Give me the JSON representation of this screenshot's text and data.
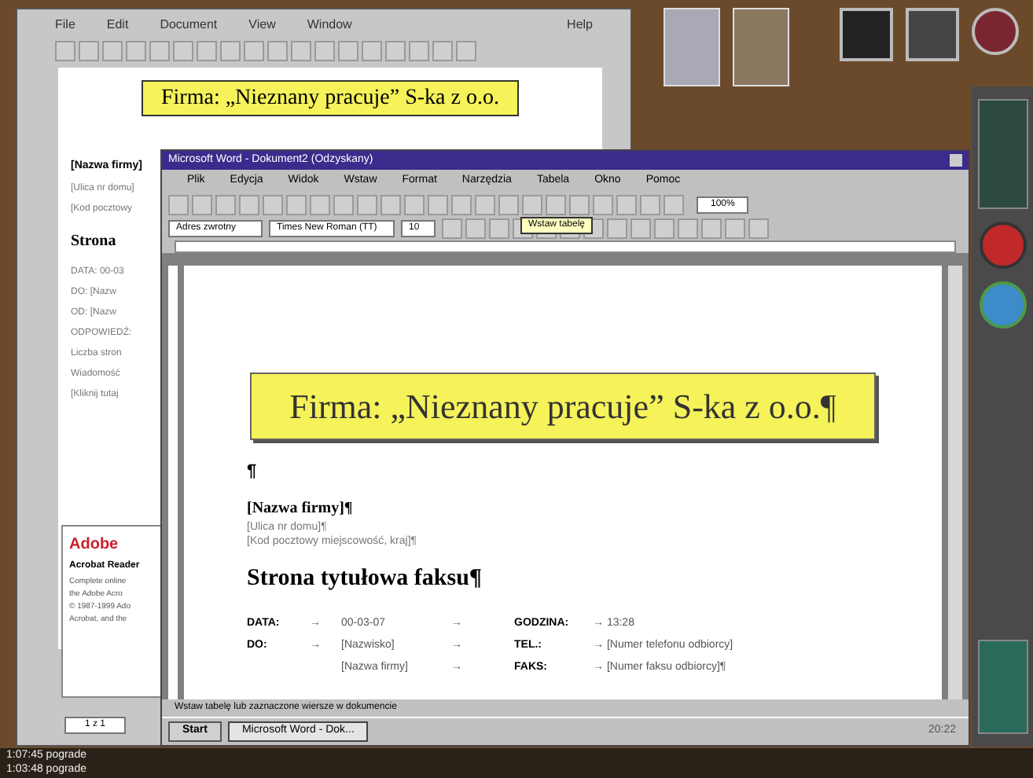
{
  "acrobat_window": {
    "menu": [
      "File",
      "Edit",
      "Document",
      "View",
      "Window",
      "Help"
    ],
    "banner": "Firma: „Nieznany pracuje” S-ka z o.o.",
    "page_lines": [
      {
        "kind": "bold",
        "text": "[Nazwa firmy]"
      },
      {
        "kind": "small",
        "text": "[Ulica nr domu]"
      },
      {
        "kind": "small",
        "text": "[Kod pocztowy"
      },
      {
        "kind": "title",
        "text": "Strona"
      },
      {
        "kind": "small",
        "text": "DATA:    00-03"
      },
      {
        "kind": "small",
        "text": "DO:      [Nazw"
      },
      {
        "kind": "small",
        "text": "OD:      [Nazw"
      },
      {
        "kind": "small",
        "text": "ODPOWIEDŹ:"
      },
      {
        "kind": "small",
        "text": "Liczba stron"
      },
      {
        "kind": "small",
        "text": "Wiadomość"
      },
      {
        "kind": "small",
        "text": "[Kliknij tutaj"
      }
    ],
    "about": {
      "logo": "Adobe",
      "title": "Acrobat Reader",
      "lines": [
        "Complete online",
        "the Adobe Acro",
        "© 1987-1999 Ado",
        "Acrobat, and the"
      ]
    },
    "page_field": "1 z 1"
  },
  "word_window": {
    "title": "Microsoft Word - Dokument2 (Odzyskany)",
    "menu": [
      "Plik",
      "Edycja",
      "Widok",
      "Wstaw",
      "Format",
      "Narzędzia",
      "Tabela",
      "Okno",
      "Pomoc"
    ],
    "style": "Adres zwrotny",
    "font": "Times New Roman (TT)",
    "size": "10",
    "zoom": "100%",
    "tooltip": "Wstaw tabelę",
    "document": [
      {
        "kind": "banner",
        "text": "Firma: „Nieznany pracuje” S-ka z o.o.¶"
      },
      {
        "kind": "mark",
        "text": "¶"
      },
      {
        "kind": "bold",
        "text": "[Nazwa firmy]¶"
      },
      {
        "kind": "small",
        "text": "[Ulica nr domu]¶"
      },
      {
        "kind": "small",
        "text": "[Kod pocztowy miejscowość, kraj]¶"
      },
      {
        "kind": "title",
        "text": "Strona tytułowa faksu¶"
      },
      {
        "kind": "fields",
        "cells": [
          "DATA:",
          "→",
          "00-03-07",
          "→",
          "GODZINA:",
          "→ 13:28"
        ]
      },
      {
        "kind": "fields",
        "cells": [
          "DO:",
          "→",
          "[Nazwisko]",
          "→",
          "TEL.:",
          "→ [Numer telefonu odbiorcy]"
        ]
      },
      {
        "kind": "fields_cont",
        "cells": [
          "[Nazwa firmy]",
          "→",
          "FAKS:",
          "→ [Numer faksu odbiorcy]¶"
        ]
      }
    ],
    "status": "Wstaw tabelę lub zaznaczone wiersze w dokumencie"
  },
  "taskbar": {
    "start": "Start",
    "tasks": [
      {
        "label": "Microsoft Word - Dok...",
        "selected": true
      }
    ],
    "clock": "20:22"
  },
  "back_taskbar": {
    "lines": [
      "1:07:45 pograde",
      "1:03:48 pograde"
    ]
  }
}
